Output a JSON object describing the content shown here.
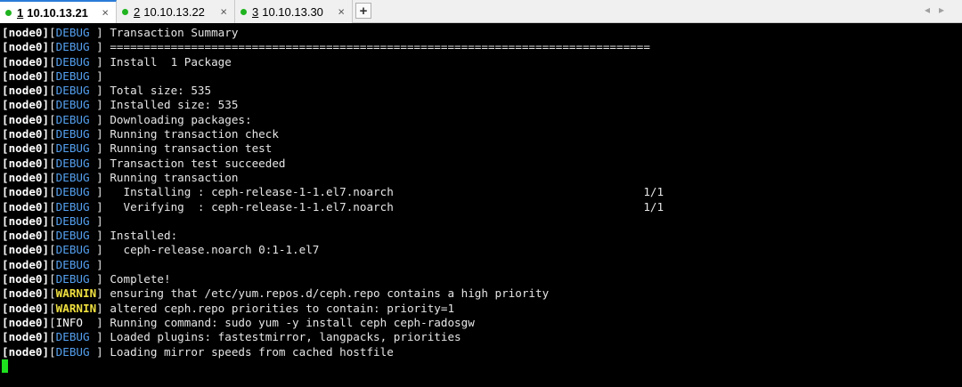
{
  "tabs": [
    {
      "num": "1",
      "label": "10.10.13.21",
      "close": "×",
      "active": true
    },
    {
      "num": "2",
      "label": "10.10.13.22",
      "close": "×",
      "active": false
    },
    {
      "num": "3",
      "label": "10.10.13.30",
      "close": "×",
      "active": false
    }
  ],
  "add_tab_label": "+",
  "nav_arrows": "◂▸",
  "colors": {
    "tab_status": "#1fb31f",
    "debug": "#55a0f0",
    "warnin": "#f0e040",
    "cursor": "#1ee01e"
  },
  "terminal": {
    "lines": [
      {
        "node": "[node0]",
        "level": "DEBUG ",
        "msg": "Transaction Summary"
      },
      {
        "node": "[node0]",
        "level": "DEBUG ",
        "msg": "================================================================================"
      },
      {
        "node": "[node0]",
        "level": "DEBUG ",
        "msg": "Install  1 Package"
      },
      {
        "node": "[node0]",
        "level": "DEBUG ",
        "msg": ""
      },
      {
        "node": "[node0]",
        "level": "DEBUG ",
        "msg": "Total size: 535"
      },
      {
        "node": "[node0]",
        "level": "DEBUG ",
        "msg": "Installed size: 535"
      },
      {
        "node": "[node0]",
        "level": "DEBUG ",
        "msg": "Downloading packages:"
      },
      {
        "node": "[node0]",
        "level": "DEBUG ",
        "msg": "Running transaction check"
      },
      {
        "node": "[node0]",
        "level": "DEBUG ",
        "msg": "Running transaction test"
      },
      {
        "node": "[node0]",
        "level": "DEBUG ",
        "msg": "Transaction test succeeded"
      },
      {
        "node": "[node0]",
        "level": "DEBUG ",
        "msg": "Running transaction"
      },
      {
        "node": "[node0]",
        "level": "DEBUG ",
        "msg": "  Installing : ceph-release-1-1.el7.noarch                                     1/1"
      },
      {
        "node": "[node0]",
        "level": "DEBUG ",
        "msg": "  Verifying  : ceph-release-1-1.el7.noarch                                     1/1"
      },
      {
        "node": "[node0]",
        "level": "DEBUG ",
        "msg": ""
      },
      {
        "node": "[node0]",
        "level": "DEBUG ",
        "msg": "Installed:"
      },
      {
        "node": "[node0]",
        "level": "DEBUG ",
        "msg": "  ceph-release.noarch 0:1-1.el7"
      },
      {
        "node": "[node0]",
        "level": "DEBUG ",
        "msg": ""
      },
      {
        "node": "[node0]",
        "level": "DEBUG ",
        "msg": "Complete!"
      },
      {
        "node": "[node0]",
        "level": "WARNIN",
        "msg": "ensuring that /etc/yum.repos.d/ceph.repo contains a high priority"
      },
      {
        "node": "[node0]",
        "level": "WARNIN",
        "msg": "altered ceph.repo priorities to contain: priority=1"
      },
      {
        "node": "[node0]",
        "level": "INFO  ",
        "msg": "Running command: sudo yum -y install ceph ceph-radosgw"
      },
      {
        "node": "[node0]",
        "level": "DEBUG ",
        "msg": "Loaded plugins: fastestmirror, langpacks, priorities"
      },
      {
        "node": "[node0]",
        "level": "DEBUG ",
        "msg": "Loading mirror speeds from cached hostfile"
      }
    ]
  }
}
